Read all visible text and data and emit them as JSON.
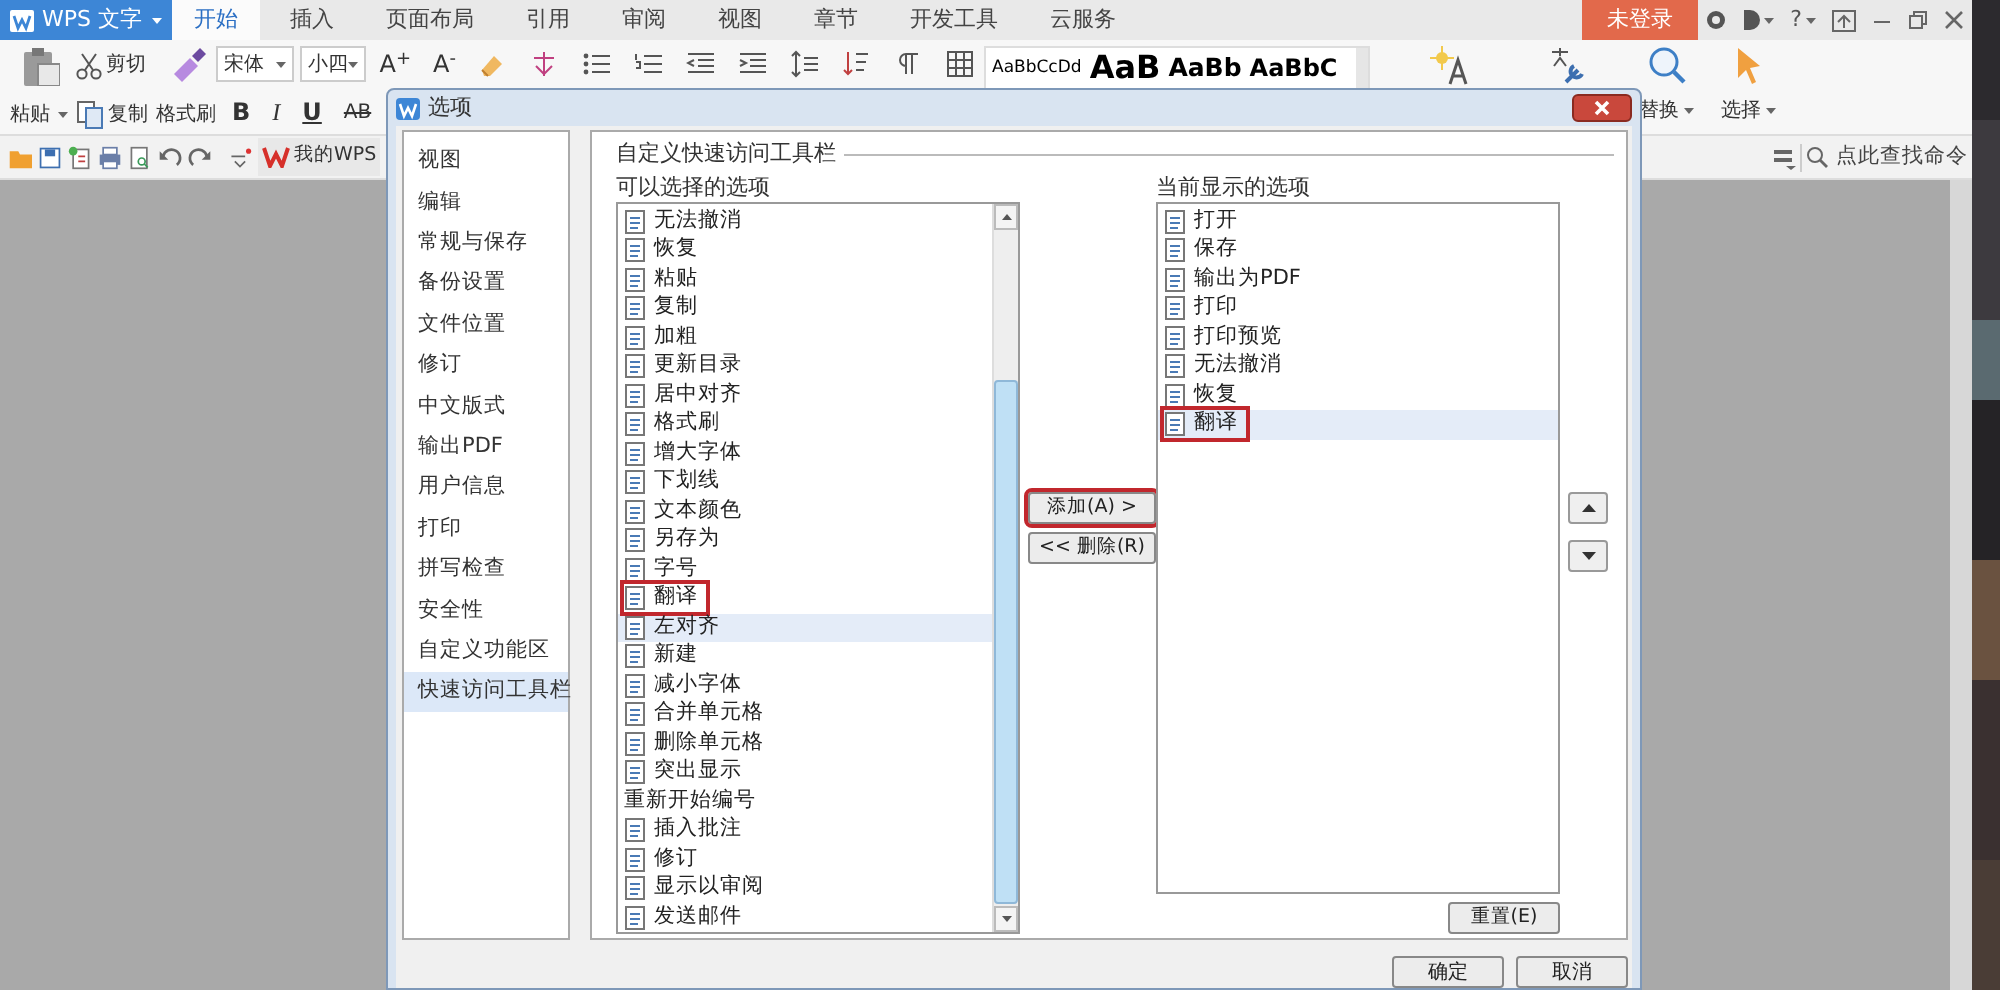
{
  "app_menu": {
    "label": "WPS 文字"
  },
  "ribbon_tabs": [
    {
      "label": "开始",
      "selected": true
    },
    {
      "label": "插入",
      "selected": false
    },
    {
      "label": "页面布局",
      "selected": false
    },
    {
      "label": "引用",
      "selected": false
    },
    {
      "label": "审阅",
      "selected": false
    },
    {
      "label": "视图",
      "selected": false
    },
    {
      "label": "章节",
      "selected": false
    },
    {
      "label": "开发工具",
      "selected": false
    },
    {
      "label": "云服务",
      "selected": false
    }
  ],
  "login_button": "未登录",
  "help_button": "?",
  "ribbon": {
    "paste": "粘贴",
    "cut": "剪切",
    "copy": "复制",
    "format_painter": "格式刷",
    "font_name": "宋体",
    "font_size": "小四",
    "size_buttons": [
      "A$^{+}$",
      "A$^{-}$"
    ],
    "format_buttons": [
      {
        "label": "B",
        "kind": "bold"
      },
      {
        "label": "I",
        "kind": "italic"
      },
      {
        "label": "U",
        "kind": "underline"
      },
      {
        "label": "AB",
        "kind": "strike"
      }
    ],
    "styles": [
      {
        "sample": "AaBbCcDd",
        "kind": "body"
      },
      {
        "sample": "AaB",
        "kind": "heading1"
      },
      {
        "sample": "AaBb",
        "kind": "heading2"
      },
      {
        "sample": "AaBbC",
        "kind": "heading3"
      }
    ],
    "replace": "替换",
    "select": "选择"
  },
  "quick_access": {
    "my_wps": "我的WPS",
    "command_search": {
      "placeholder": "点此查找命令"
    }
  },
  "dialog": {
    "title": "选项",
    "nav": [
      {
        "label": "视图",
        "selected": false
      },
      {
        "label": "编辑",
        "selected": false
      },
      {
        "label": "常规与保存",
        "selected": false
      },
      {
        "label": "备份设置",
        "selected": false
      },
      {
        "label": "文件位置",
        "selected": false
      },
      {
        "label": "修订",
        "selected": false
      },
      {
        "label": "中文版式",
        "selected": false
      },
      {
        "label": "输出PDF",
        "selected": false
      },
      {
        "label": "用户信息",
        "selected": false
      },
      {
        "label": "打印",
        "selected": false
      },
      {
        "label": "拼写检查",
        "selected": false
      },
      {
        "label": "安全性",
        "selected": false
      },
      {
        "label": "自定义功能区",
        "selected": false
      },
      {
        "label": "快速访问工具栏",
        "selected": true
      }
    ],
    "group_title": "自定义快速访问工具栏",
    "available_label": "可以选择的选项",
    "available": [
      {
        "label": "无法撤消",
        "selected": false,
        "annotated": false
      },
      {
        "label": "恢复",
        "selected": false,
        "annotated": false
      },
      {
        "label": "粘贴",
        "selected": false,
        "annotated": false
      },
      {
        "label": "复制",
        "selected": false,
        "annotated": false
      },
      {
        "label": "加粗",
        "selected": false,
        "annotated": false
      },
      {
        "label": "更新目录",
        "selected": false,
        "annotated": false
      },
      {
        "label": "居中对齐",
        "selected": false,
        "annotated": false
      },
      {
        "label": "格式刷",
        "selected": false,
        "annotated": false
      },
      {
        "label": "增大字体",
        "selected": false,
        "annotated": false
      },
      {
        "label": "下划线",
        "selected": false,
        "annotated": false
      },
      {
        "label": "文本颜色",
        "selected": false,
        "annotated": false
      },
      {
        "label": "另存为",
        "selected": false,
        "annotated": false
      },
      {
        "label": "字号",
        "selected": false,
        "annotated": false
      },
      {
        "label": "翻译",
        "selected": false,
        "annotated": true
      },
      {
        "label": "左对齐",
        "selected": true,
        "annotated": false
      },
      {
        "label": "新建",
        "selected": false,
        "annotated": false
      },
      {
        "label": "减小字体",
        "selected": false,
        "annotated": false
      },
      {
        "label": "合并单元格",
        "selected": false,
        "annotated": false
      },
      {
        "label": "删除单元格",
        "selected": false,
        "annotated": false
      },
      {
        "label": "突出显示",
        "selected": false,
        "annotated": false
      },
      {
        "label": "重新开始编号",
        "selected": false,
        "annotated": false,
        "kind": "plain"
      },
      {
        "label": "插入批注",
        "selected": false,
        "annotated": false
      },
      {
        "label": "修订",
        "selected": false,
        "annotated": false
      },
      {
        "label": "显示以审阅",
        "selected": false,
        "annotated": false
      },
      {
        "label": "发送邮件",
        "selected": false,
        "annotated": false
      }
    ],
    "add_button": {
      "label": "添加(A) >",
      "annotated": true
    },
    "remove_button": "<< 删除(R)",
    "current_label": "当前显示的选项",
    "current": [
      {
        "label": "打开",
        "selected": false,
        "annotated": false
      },
      {
        "label": "保存",
        "selected": false,
        "annotated": false
      },
      {
        "label": "输出为PDF",
        "selected": false,
        "annotated": false
      },
      {
        "label": "打印",
        "selected": false,
        "annotated": false
      },
      {
        "label": "打印预览",
        "selected": false,
        "annotated": false
      },
      {
        "label": "无法撤消",
        "selected": false,
        "annotated": false
      },
      {
        "label": "恢复",
        "selected": false,
        "annotated": false
      },
      {
        "label": "翻译",
        "selected": true,
        "annotated": true
      }
    ],
    "reset_button": "重置(E)",
    "ok_button": "确定",
    "cancel_button": "取消"
  }
}
